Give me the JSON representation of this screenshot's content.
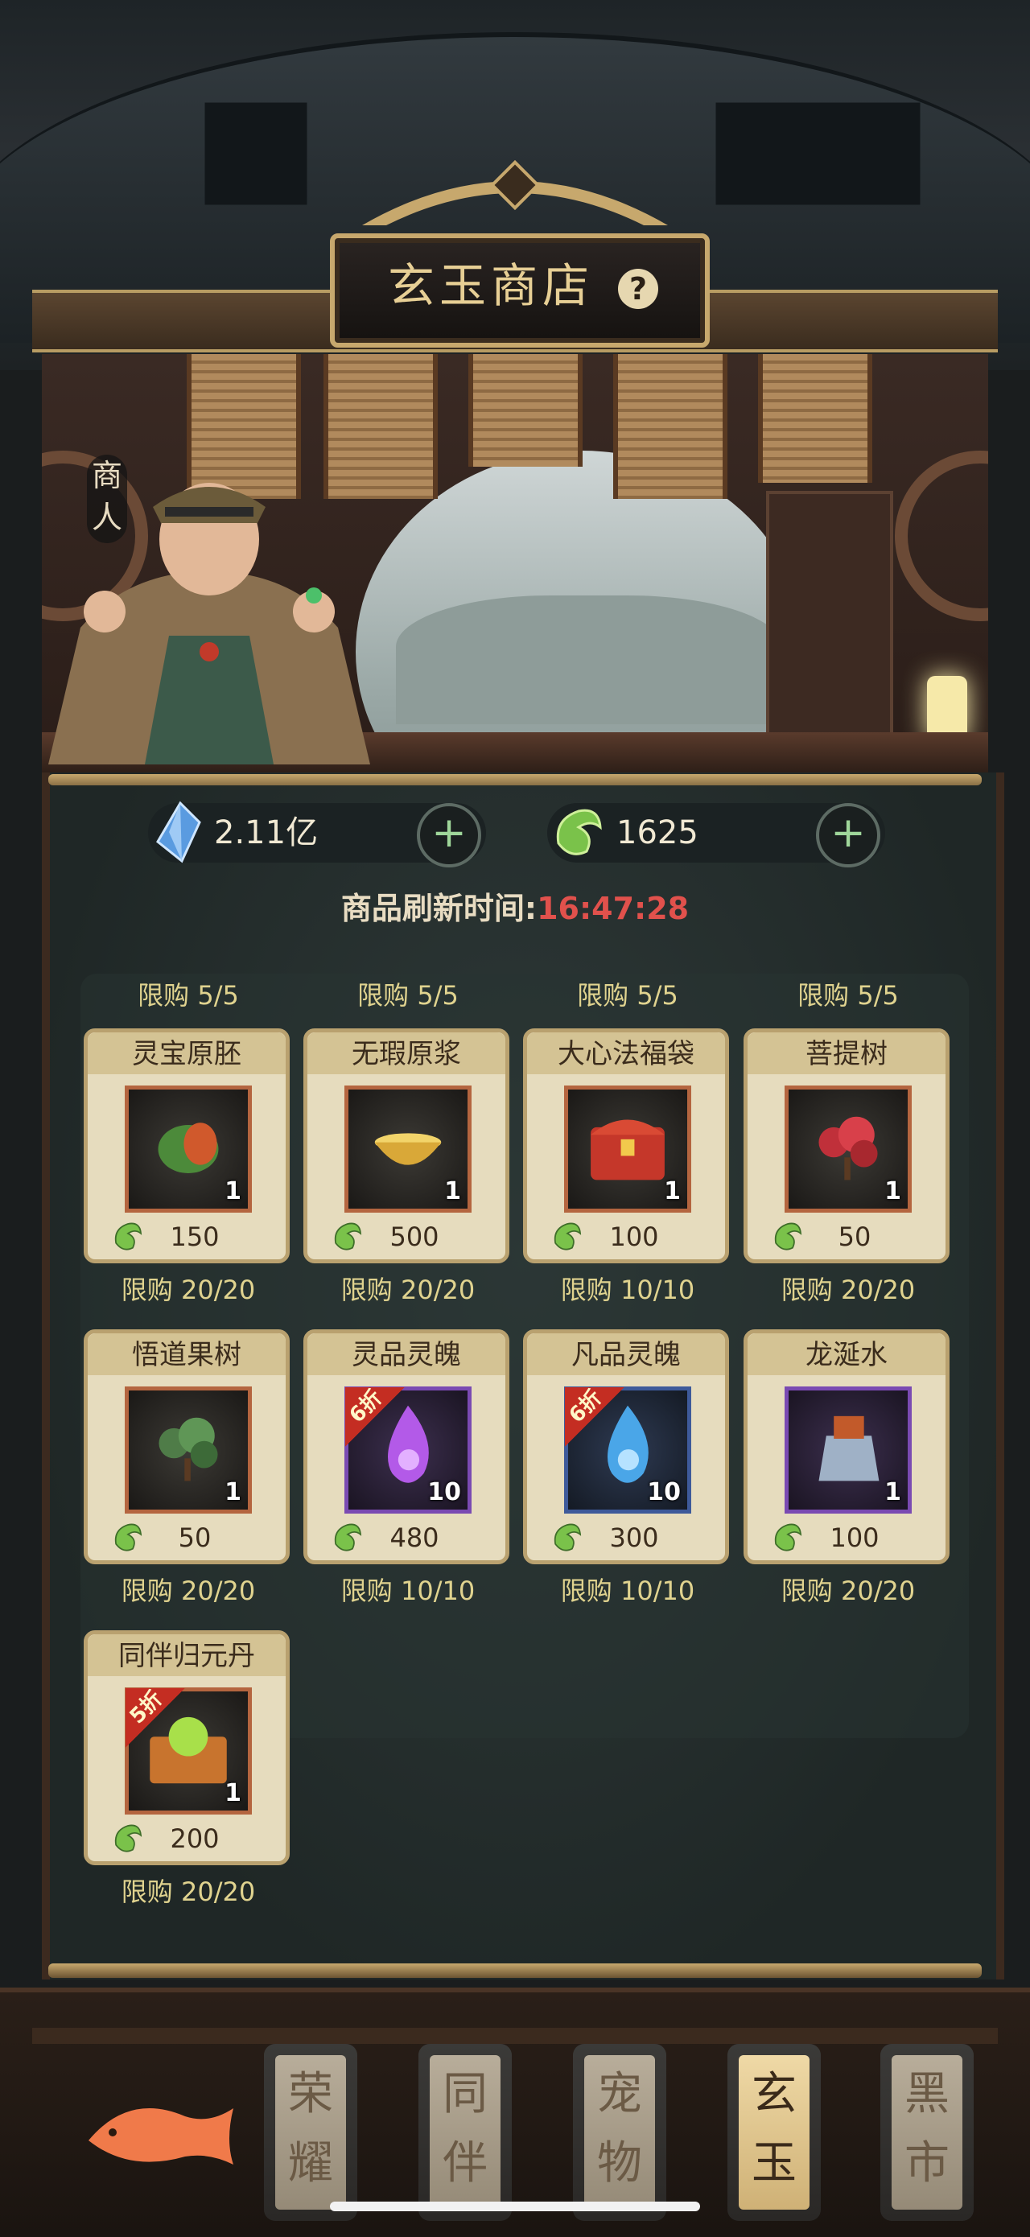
{
  "header": {
    "title": "玄玉商店",
    "help_symbol": "?"
  },
  "merchant": {
    "tag": "商\n人"
  },
  "currencies": [
    {
      "name": "spirit-crystal",
      "value": "2.11亿",
      "icon": "blue-crystal-icon"
    },
    {
      "name": "xuan-jade",
      "value": "1625",
      "icon": "green-jade-icon"
    }
  ],
  "add_symbol": "+",
  "refresh": {
    "label": "商品刷新时间:",
    "time": "16:47:28"
  },
  "top_limits": [
    "限购 5/5",
    "限购 5/5",
    "限购 5/5",
    "限购 5/5"
  ],
  "items": [
    {
      "name": "灵宝原胚",
      "qty": "1",
      "price": "150",
      "limit": "限购 20/20",
      "frame": "orange",
      "discount": "",
      "icon": "jade-embryo-icon"
    },
    {
      "name": "无瑕原浆",
      "qty": "1",
      "price": "500",
      "limit": "限购 20/20",
      "frame": "orange",
      "discount": "",
      "icon": "golden-bowl-icon"
    },
    {
      "name": "大心法福袋",
      "qty": "1",
      "price": "100",
      "limit": "限购 10/10",
      "frame": "orange",
      "discount": "",
      "icon": "treasure-chest-icon"
    },
    {
      "name": "菩提树",
      "qty": "1",
      "price": "50",
      "limit": "限购 20/20",
      "frame": "orange",
      "discount": "",
      "icon": "bodhi-tree-icon"
    },
    {
      "name": "悟道果树",
      "qty": "1",
      "price": "50",
      "limit": "限购 20/20",
      "frame": "orange",
      "discount": "",
      "icon": "fruit-tree-icon"
    },
    {
      "name": "灵品灵魄",
      "qty": "10",
      "price": "480",
      "limit": "限购 10/10",
      "frame": "purple",
      "discount": "6折",
      "icon": "purple-flame-icon"
    },
    {
      "name": "凡品灵魄",
      "qty": "10",
      "price": "300",
      "limit": "限购 10/10",
      "frame": "blue",
      "discount": "6折",
      "icon": "blue-flame-icon"
    },
    {
      "name": "龙涎水",
      "qty": "1",
      "price": "100",
      "limit": "限购 20/20",
      "frame": "purple",
      "discount": "",
      "icon": "dragon-flask-icon"
    },
    {
      "name": "同伴归元丹",
      "qty": "1",
      "price": "200",
      "limit": "限购 20/20",
      "frame": "orange",
      "discount": "5折",
      "icon": "pill-chest-icon"
    }
  ],
  "nav_tabs": [
    {
      "label": "荣\n耀",
      "active": false
    },
    {
      "label": "同\n伴",
      "active": false
    },
    {
      "label": "宠\n物",
      "active": false
    },
    {
      "label": "玄\n玉",
      "active": true
    },
    {
      "label": "黑\n市",
      "active": false
    }
  ],
  "colors": {
    "accent_gold": "#c7a86d",
    "timer_red": "#e1514c",
    "limit_yellow": "#e0d38f",
    "card_bg": "#e6dcbe"
  }
}
